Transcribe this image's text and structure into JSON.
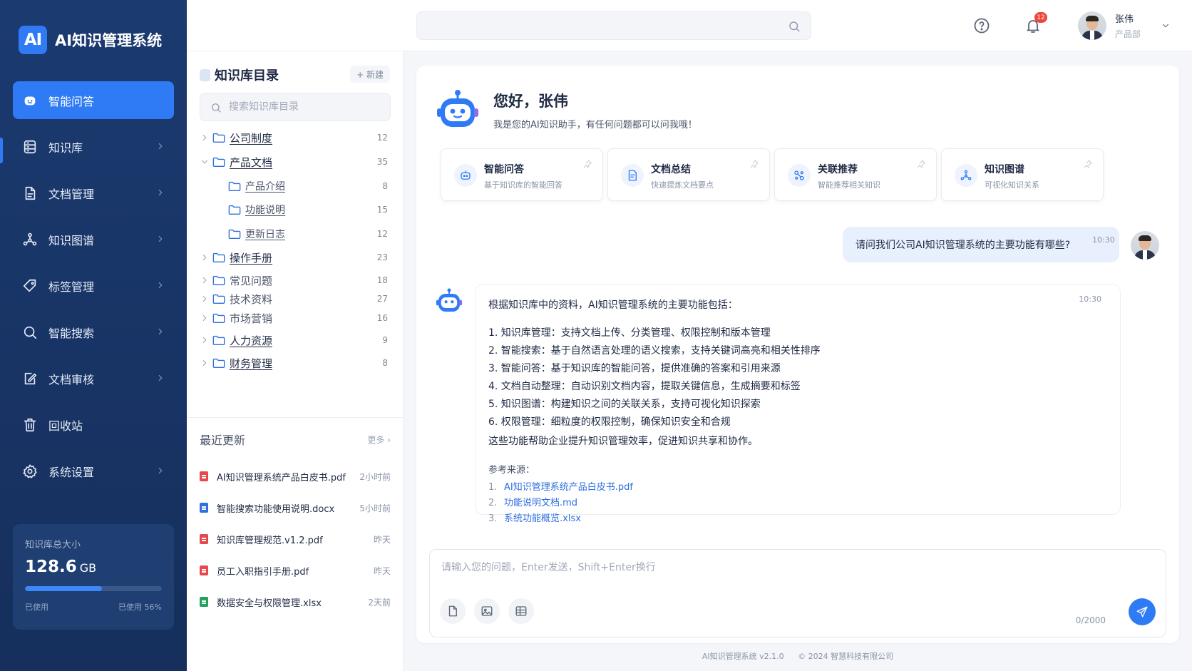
{
  "brand": {
    "logo": "AI",
    "title": "AI知识管理系统"
  },
  "nav": [
    {
      "label": "智能问答",
      "icon": "robot-icon",
      "active": true
    },
    {
      "label": "知识库",
      "icon": "database-icon"
    },
    {
      "label": "文档管理",
      "icon": "document-icon"
    },
    {
      "label": "知识图谱",
      "icon": "graph-icon"
    },
    {
      "label": "标签管理",
      "icon": "tag-icon"
    },
    {
      "label": "智能搜索",
      "icon": "search-icon"
    },
    {
      "label": "文档审核",
      "icon": "review-icon"
    },
    {
      "label": "回收站",
      "icon": "trash-icon"
    },
    {
      "label": "系统设置",
      "icon": "gear-icon"
    }
  ],
  "storage": {
    "label": "知识库总大小",
    "value": "128.6",
    "unit": "GB",
    "used_label": "已使用",
    "used_pct_label": "已使用 56%",
    "used_fraction": 0.56
  },
  "topbar": {
    "search_placeholder": "",
    "notifications": "12",
    "user_name": "张伟",
    "user_dept": "产品部"
  },
  "tree": {
    "title": "知识库目录",
    "new_label": "+ 新建",
    "search_placeholder": "搜索知识库目录",
    "items": [
      {
        "label": "公司制度",
        "count": "12",
        "level": 0,
        "expanded": false
      },
      {
        "label": "产品文档",
        "count": "35",
        "level": 0,
        "expanded": true
      },
      {
        "label": "产品介绍",
        "count": "8",
        "level": 1
      },
      {
        "label": "功能说明",
        "count": "15",
        "level": 1
      },
      {
        "label": "更新日志",
        "count": "12",
        "level": 1
      },
      {
        "label": "操作手册",
        "count": "23",
        "level": 0,
        "expanded": false
      },
      {
        "label": "常见问题",
        "count": "18",
        "level": 0,
        "expanded": false
      },
      {
        "label": "技术资料",
        "count": "27",
        "level": 0,
        "expanded": false
      },
      {
        "label": "市场营销",
        "count": "16",
        "level": 0,
        "expanded": false
      },
      {
        "label": "人力资源",
        "count": "9",
        "level": 0,
        "expanded": false
      },
      {
        "label": "财务管理",
        "count": "8",
        "level": 0,
        "expanded": false
      }
    ]
  },
  "recent": {
    "title": "最近更新",
    "more": "更多 ›",
    "items": [
      {
        "name": "AI知识管理系统产品白皮书.pdf",
        "time": "2小时前",
        "color": "#e5484d"
      },
      {
        "name": "智能搜索功能使用说明.docx",
        "time": "5小时前",
        "color": "#2f6fe0"
      },
      {
        "name": "知识库管理规范.v1.2.pdf",
        "time": "昨天",
        "color": "#e5484d"
      },
      {
        "name": "员工入职指引手册.pdf",
        "time": "昨天",
        "color": "#e5484d"
      },
      {
        "name": "数据安全与权限管理.xlsx",
        "time": "2天前",
        "color": "#22a15a"
      }
    ]
  },
  "chat": {
    "greeting": "您好，张伟",
    "greeting_sub": "我是您的AI知识助手，有任何问题都可以问我哦！",
    "cards": [
      {
        "title": "智能问答",
        "sub": "基于知识库的智能回答",
        "icon": "chat-bot-icon"
      },
      {
        "title": "文档总结",
        "sub": "快速提炼文档要点",
        "icon": "summary-icon"
      },
      {
        "title": "关联推荐",
        "sub": "智能推荐相关知识",
        "icon": "link-icon"
      },
      {
        "title": "知识图谱",
        "sub": "可视化知识关系",
        "icon": "graph-icon"
      }
    ],
    "question": "请问我们公司AI知识管理系统的主要功能有哪些?",
    "question_time": "10:30",
    "answer_time": "10:30",
    "answer_intro": "根据知识库中的资料，AI知识管理系统的主要功能包括：",
    "answer_items": [
      "1.  知识库管理：支持文档上传、分类管理、权限控制和版本管理",
      "2.  智能搜索：基于自然语言处理的语义搜索，支持关键词高亮和相关性排序",
      "3.  智能问答：基于知识库的智能问答，提供准确的答案和引用来源",
      "4.  文档自动整理：自动识别文档内容，提取关键信息，生成摘要和标签",
      "5.  知识图谱：构建知识之间的关联关系，支持可视化知识探索",
      "6.  权限管理：细粒度的权限控制，确保知识安全和合规"
    ],
    "answer_conclusion": "这些功能帮助企业提升知识管理效率，促进知识共享和协作。",
    "ref_title": "参考来源：",
    "refs": [
      {
        "n": "1.",
        "name": "AI知识管理系统产品白皮书.pdf"
      },
      {
        "n": "2.",
        "name": "功能说明文档.md"
      },
      {
        "n": "3.",
        "name": "系统功能概览.xlsx"
      }
    ],
    "input_placeholder": "请输入您的问题，Enter发送，Shift+Enter换行",
    "counter": "0/2000"
  },
  "footer": {
    "version": "AI知识管理系统 v2.1.0",
    "copyright": "© 2024 智慧科技有限公司"
  },
  "colors": {
    "sidebar": "#1b3a70",
    "accent": "#2f7bf5"
  }
}
